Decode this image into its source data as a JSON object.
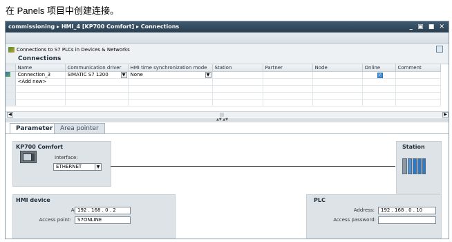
{
  "caption": "在 Panels 项目中创建连接。",
  "window": {
    "breadcrumb": "commissioning ▸ HMI_4 [KP700 Comfort] ▸ Connections",
    "controls": "_ ▣ ■ ✕"
  },
  "toolbar": {
    "link_text": "Connections to S7 PLCs in Devices & Networks"
  },
  "connections": {
    "title": "Connections",
    "columns": [
      "Name",
      "Communication driver",
      "HMI time synchronization mode",
      "Station",
      "Partner",
      "Node",
      "Online",
      "Comment"
    ],
    "rows": [
      {
        "name": "Connection_3",
        "driver": "SIMATIC S7 1200",
        "time_sync": "None",
        "station": "",
        "partner": "",
        "node": "",
        "online": true,
        "comment": ""
      }
    ],
    "add_new": "<Add new>"
  },
  "tabs": [
    "Parameter",
    "Area pointer"
  ],
  "hmi": {
    "device_name": "KP700 Comfort",
    "interface_label": "Interface:",
    "interface_value": "ETHERNET",
    "section_title": "HMI device",
    "address_label": "Address:",
    "address_value": "192 . 168 . 0 . 2",
    "access_point_label": "Access point:",
    "access_point_value": "S7ONLINE"
  },
  "station": {
    "title": "Station"
  },
  "plc": {
    "section_title": "PLC",
    "address_label": "Address:",
    "address_value": "192 . 168 . 0 . 10",
    "password_label": "Access password:",
    "password_value": ""
  }
}
